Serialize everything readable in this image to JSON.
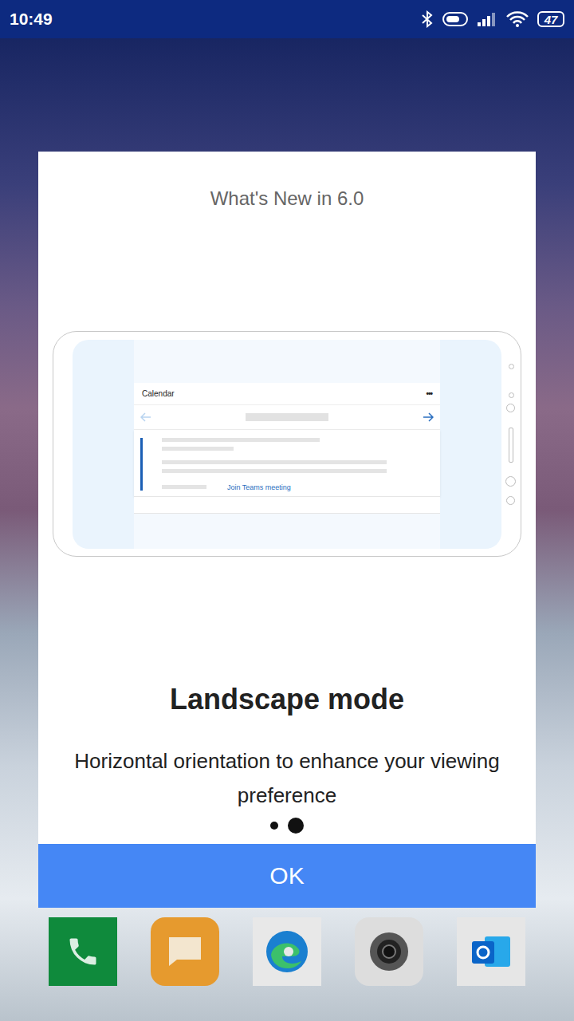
{
  "status_bar": {
    "time": "10:49",
    "battery": "47"
  },
  "dialog": {
    "heading": "What's New in 6.0",
    "illustration": {
      "app_title": "Calendar",
      "menu": "•••",
      "link": "Join Teams meeting"
    },
    "title": "Landscape mode",
    "description": "Horizontal orientation to enhance your viewing preference",
    "pages": [
      {
        "selected": false
      },
      {
        "selected": true
      }
    ],
    "button": "OK"
  }
}
